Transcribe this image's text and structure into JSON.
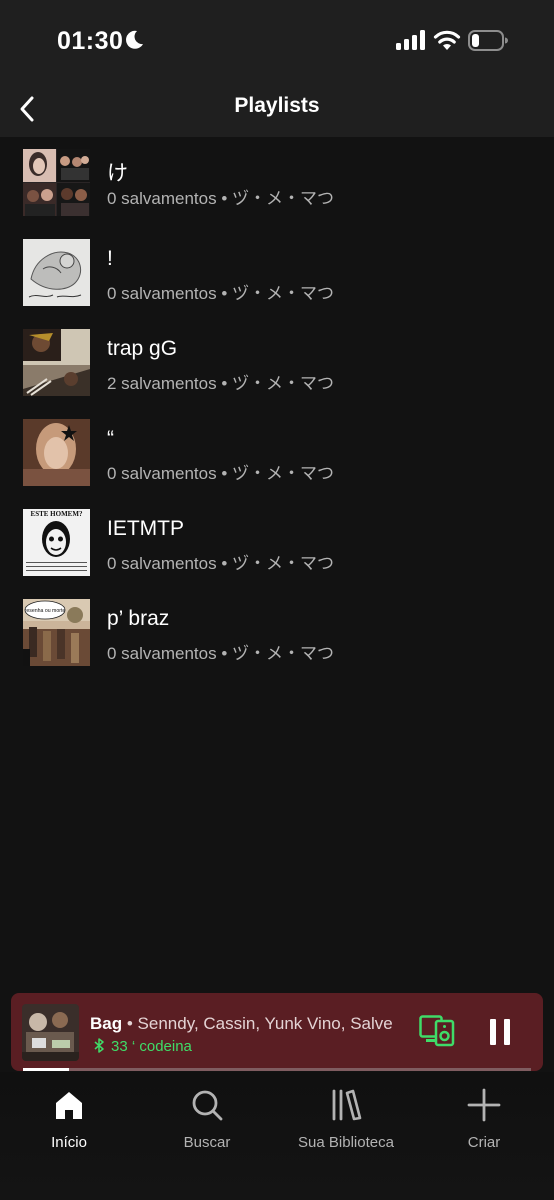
{
  "status": {
    "time": "01:30"
  },
  "header": {
    "title": "Playlists"
  },
  "playlists": [
    {
      "title": "け",
      "saves": "0 salvamentos",
      "owner": "ヅ・メ・マつ"
    },
    {
      "title": "!",
      "saves": "0 salvamentos",
      "owner": "ヅ・メ・マつ"
    },
    {
      "title": "trap gG",
      "saves": "2 salvamentos",
      "owner": "ヅ・メ・マつ"
    },
    {
      "title": "“",
      "saves": "0 salvamentos",
      "owner": "ヅ・メ・マつ"
    },
    {
      "title": "IETMTP",
      "saves": "0 salvamentos",
      "owner": "ヅ・メ・マつ"
    },
    {
      "title": "p’ braz",
      "saves": "0 salvamentos",
      "owner": "ヅ・メ・マつ"
    }
  ],
  "thumb_texts": {
    "este_homem": "ESTE HOMEM?",
    "resenha": "resenha ou morte"
  },
  "player": {
    "song": "Bag",
    "separator": "•",
    "artists": "Senndy, Cassin, Yunk Vino, Salve",
    "device": "33 ‘ codeina",
    "progress": 0.09,
    "accent": "#3fdc68",
    "background": "#5a1e23"
  },
  "nav": [
    {
      "label": "Início",
      "icon": "home-icon",
      "active": true
    },
    {
      "label": "Buscar",
      "icon": "search-icon",
      "active": false
    },
    {
      "label": "Sua Biblioteca",
      "icon": "library-icon",
      "active": false
    },
    {
      "label": "Criar",
      "icon": "plus-icon",
      "active": false
    }
  ]
}
